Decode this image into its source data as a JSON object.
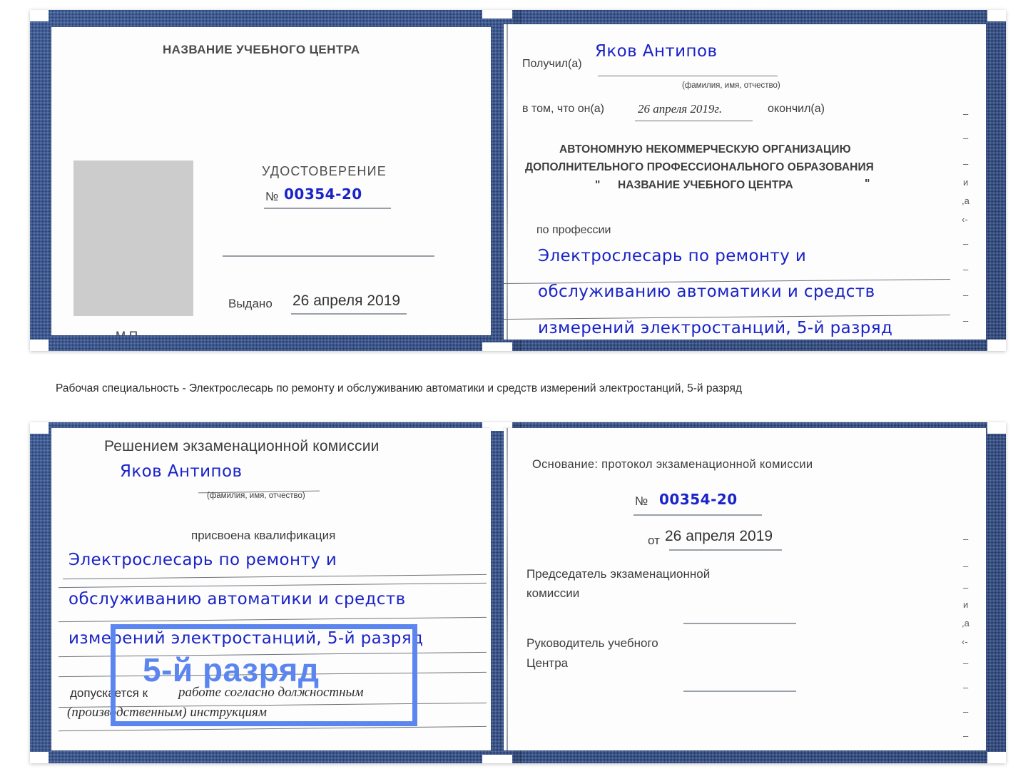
{
  "document": {
    "kind": "certificate-scan",
    "colors": {
      "cover_blue": "#28488a",
      "ink_blue": "#1a23c8",
      "annotation_blue": "#5c86ef",
      "photo_placeholder": "#cccccc"
    }
  },
  "caption": {
    "text": "Рабочая специальность - Электрослесарь по ремонту и обслуживанию автоматики и средств измерений электростанций, 5-й разряд"
  },
  "annotation": {
    "label": "5-й разряд"
  },
  "cert_top": {
    "left_page": {
      "org_title": "НАЗВАНИЕ УЧЕБНОГО ЦЕНТРА",
      "doc_type": "УДОСТОВЕРЕНИЕ",
      "number_symbol": "№",
      "number_value": "00354-20",
      "issued_label": "Выдано",
      "issued_value": "26 апреля 2019",
      "stamp_label": "М.П.",
      "photo_alt": "photo-placeholder"
    },
    "right_page": {
      "received_label": "Получил(а)",
      "received_value": "Яков Антипов",
      "fio_hint": "(фамилия, имя, отчество)",
      "that_he_label": "в том, что он(а)",
      "finish_date": "26 апреля 2019г.",
      "finished_label": "окончил(а)",
      "org_line1": "АВТОНОМНУЮ НЕКОММЕРЧЕСКУЮ ОРГАНИЗАЦИЮ",
      "org_line2": "ДОПОЛНИТЕЛЬНОГО ПРОФЕССИОНАЛЬНОГО ОБРАЗОВАНИЯ",
      "org_quote_open": "\"",
      "org_line3": "НАЗВАНИЕ УЧЕБНОГО ЦЕНТРА",
      "org_quote_close": "\"",
      "profession_label": "по профессии",
      "profession_line1": "Электрослесарь по ремонту и",
      "profession_line2": "обслуживанию автоматики и средств",
      "profession_line3": "измерений электростанций, 5-й разряд",
      "edge_glyphs": [
        "–",
        "–",
        "–",
        "и",
        ",а",
        "‹-",
        "–",
        "–",
        "–",
        "–"
      ]
    }
  },
  "cert_bottom": {
    "left_page": {
      "commission_title": "Решением экзаменационной комиссии",
      "name_value": "Яков Антипов",
      "fio_hint": "(фамилия, имя, отчество)",
      "qualification_label": "присвоена квалификация",
      "qual_line1": "Электрослесарь по ремонту и",
      "qual_line2": "обслуживанию автоматики и средств",
      "qual_line3": "измерений электростанций, 5-й разряд",
      "allowed_label": "допускается к",
      "allowed_value1": "работе согласно должностным",
      "allowed_value2": "(производственным) инструкциям"
    },
    "right_page": {
      "basis_label": "Основание: протокол экзаменационной комиссии",
      "number_symbol": "№",
      "number_value": "00354-20",
      "from_label": "от",
      "from_value": "26 апреля 2019",
      "chair_line1": "Председатель экзаменационной",
      "chair_line2": "комиссии",
      "head_line1": "Руководитель учебного",
      "head_line2": "Центра",
      "edge_glyphs": [
        "–",
        "–",
        "–",
        "и",
        ",а",
        "‹-",
        "–",
        "–",
        "–",
        "–"
      ]
    }
  }
}
